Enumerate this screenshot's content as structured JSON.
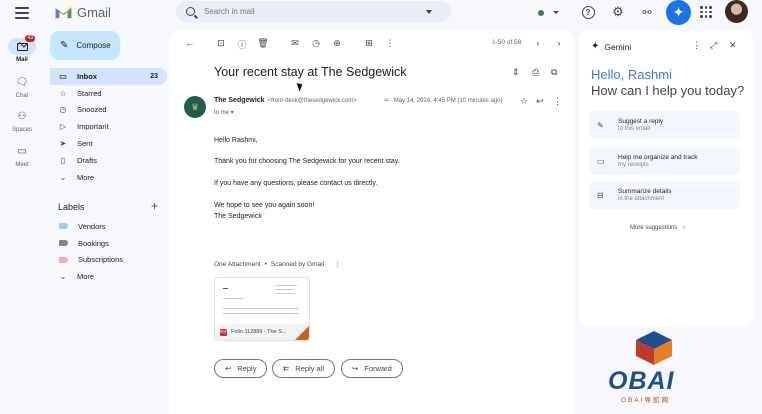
{
  "app": {
    "name": "Gmail"
  },
  "search": {
    "placeholder": "Search in mail"
  },
  "rail": [
    {
      "label": "Mail",
      "badge": "43"
    },
    {
      "label": "Chat"
    },
    {
      "label": "Spaces"
    },
    {
      "label": "Meet"
    }
  ],
  "compose_label": "Compose",
  "nav": [
    {
      "label": "Inbox",
      "count": "23",
      "icon": "inbox-icon"
    },
    {
      "label": "Starred",
      "icon": "star-icon"
    },
    {
      "label": "Snoozed",
      "icon": "clock-icon"
    },
    {
      "label": "Important",
      "icon": "important-icon"
    },
    {
      "label": "Sent",
      "icon": "send-icon"
    },
    {
      "label": "Drafts",
      "icon": "draft-icon"
    },
    {
      "label": "More",
      "icon": "chevron-down-icon"
    }
  ],
  "labels": {
    "title": "Labels",
    "items": [
      {
        "label": "Vendors",
        "color": "#a8c7fa"
      },
      {
        "label": "Bookings",
        "color": "#80868b"
      },
      {
        "label": "Subscriptions",
        "color": "#f6aea9"
      },
      {
        "label": "More"
      }
    ]
  },
  "toolbar": {
    "pager": "1-50 of 58"
  },
  "message": {
    "subject": "Your recent stay at The Sedgewick",
    "sender_name": "The Sedgewick",
    "sender_email": "<front-desk@thesedgewick.com>",
    "to": "to me",
    "date": "May 14, 2024, 4:45 PM (10 minutes ago)",
    "body": [
      "Hello Rashmi,",
      "Thank you for choosing The Sedgewick for your recent stay.",
      "If you have any questions, please contact us directly.",
      "We hope to see you again soon!",
      "The Sedgewick"
    ],
    "attachment_heading": "One Attachment",
    "attachment_scan": "Scanned by Gmail",
    "attachment_name": "Folio 112889 - The S..."
  },
  "actions": {
    "reply": "Reply",
    "reply_all": "Reply all",
    "forward": "Forward"
  },
  "gemini": {
    "title": "Gemini",
    "hello": "Hello, Rashmi",
    "prompt": "How can I help you today?",
    "suggestions": [
      {
        "main": "Suggest a reply",
        "sub": "to this email"
      },
      {
        "main": "Help me organize and track",
        "sub": "my receipts"
      },
      {
        "main": "Summarize details",
        "sub": "in the attachment"
      }
    ],
    "more": "More suggestions"
  },
  "watermark": {
    "text": "OBAI",
    "sub": "OBAI导航网"
  },
  "colors": {
    "accent": "#1a73e8",
    "compose_bg": "#c2e7ff",
    "inbox_active": "#d3e3fd"
  }
}
